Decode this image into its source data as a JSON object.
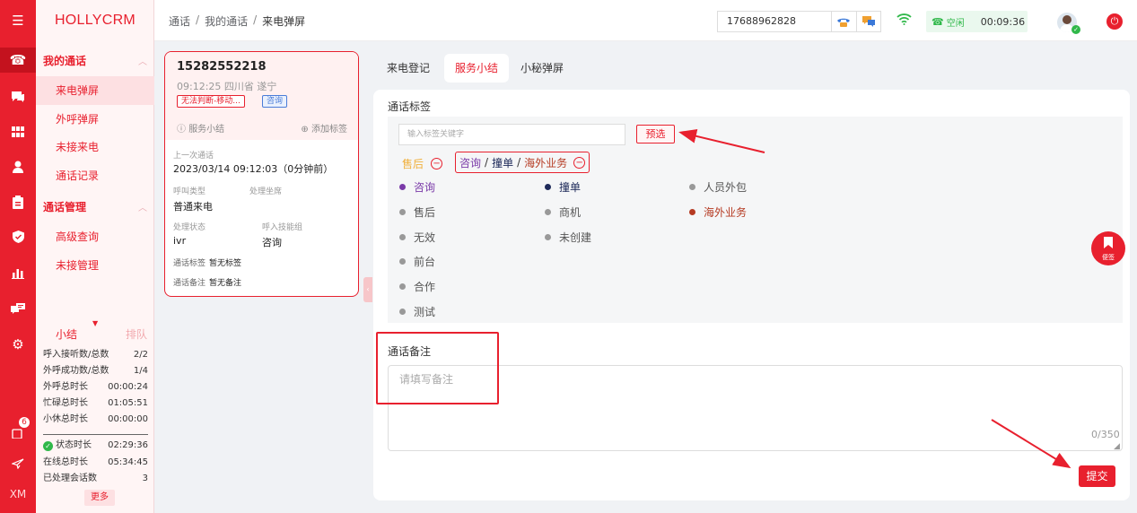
{
  "app": {
    "brand": "HOLLYCRM"
  },
  "rail": {
    "icons": [
      "menu-icon",
      "phone-icon",
      "chat-icon",
      "grid-icon",
      "user-icon",
      "clipboard-icon",
      "shield-icon",
      "chart-icon",
      "comment-icon",
      "gear-icon",
      "notification-icon",
      "send-icon"
    ],
    "badge": "6",
    "user_initials": "XM"
  },
  "sidebar": {
    "group1": {
      "label": "我的通话",
      "items": [
        "来电弹屏",
        "外呼弹屏",
        "未接来电",
        "通话记录"
      ]
    },
    "group2": {
      "label": "通话管理",
      "items": [
        "高级查询",
        "未接管理"
      ]
    },
    "stats": {
      "tab_summary": "小结",
      "tab_queue": "排队",
      "rows": [
        {
          "label": "呼入接听数/总数",
          "value": "2/2"
        },
        {
          "label": "外呼成功数/总数",
          "value": "1/4"
        },
        {
          "label": "外呼总时长",
          "value": "00:00:24"
        },
        {
          "label": "忙碌总时长",
          "value": "01:05:51"
        },
        {
          "label": "小休总时长",
          "value": "00:00:00"
        }
      ],
      "rows2": [
        {
          "label": "状态时长",
          "value": "02:29:36"
        },
        {
          "label": "在线总时长",
          "value": "05:34:45"
        },
        {
          "label": "已处理会话数",
          "value": "3"
        }
      ],
      "more": "更多"
    }
  },
  "header": {
    "breadcrumb": [
      "通话",
      "我的通话",
      "来电弹屏"
    ],
    "phone": "17688962828",
    "status_label": "空闲",
    "timer": "00:09:36"
  },
  "caller": {
    "number": "15282552218",
    "time_location": "09:12:25 四川省 遂宁",
    "tag_operator": "无法判断-移动...",
    "tag_consult": "咨询",
    "action_summary": "服务小结",
    "action_add_tag": "添加标签",
    "last_call_label": "上一次通话",
    "last_call_value": "2023/03/14 09:12:03（0分钟前）",
    "call_type_label": "呼叫类型",
    "call_type_value": "普通来电",
    "seat_label": "处理坐席",
    "seat_value": "",
    "state_label": "处理状态",
    "state_value": "ivr",
    "skill_label": "呼入技能组",
    "skill_value": "咨询",
    "tags_label": "通话标签",
    "tags_value": "暂无标签",
    "remark_label": "通话备注",
    "remark_value": "暂无备注"
  },
  "tabs": [
    "来电登记",
    "服务小结",
    "小秘弹屏"
  ],
  "tags_section": {
    "title": "通话标签",
    "search_placeholder": "输入标签关键字",
    "preset_button": "预选",
    "selected": {
      "after_sales": "售后",
      "path": [
        "咨询",
        "撞单",
        "海外业务"
      ]
    },
    "options": [
      {
        "label": "咨询",
        "color": "#7a3aa8"
      },
      {
        "label": "撞单",
        "color": "#1e2a5a"
      },
      {
        "label": "人员外包",
        "color": "#999999"
      },
      {
        "label": "售后",
        "color": "#999999"
      },
      {
        "label": "商机",
        "color": "#999999"
      },
      {
        "label": "海外业务",
        "color": "#b53a22"
      },
      {
        "label": "无效",
        "color": "#999999"
      },
      {
        "label": "未创建",
        "color": "#999999"
      },
      {
        "label": "前台",
        "color": "#999999"
      },
      {
        "label": "合作",
        "color": "#999999"
      },
      {
        "label": "测试",
        "color": "#999999"
      }
    ]
  },
  "remark_section": {
    "title": "通话备注",
    "placeholder": "请填写备注",
    "counter": "0/350"
  },
  "submit": "提交",
  "notes": "便签",
  "colors": {
    "brand": "#e8202e",
    "ok": "#30b84a"
  }
}
